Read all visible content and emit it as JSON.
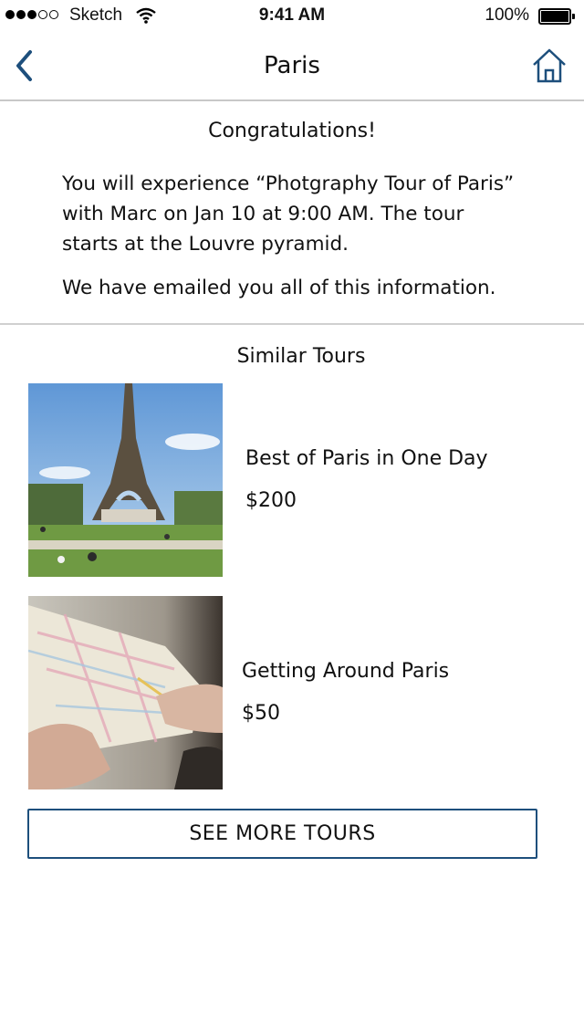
{
  "status_bar": {
    "carrier": "Sketch",
    "time": "9:41 AM",
    "battery": "100%"
  },
  "nav": {
    "title": "Paris",
    "back_icon": "chevron-left-icon",
    "home_icon": "home-icon"
  },
  "confirmation": {
    "heading": "Congratulations!",
    "body": "You will experience “Photgraphy Tour of Paris” with Marc on Jan 10 at 9:00 AM. The tour starts at the Louvre pyramid.",
    "email_note": "We have emailed you all of this information."
  },
  "similar": {
    "heading": "Similar Tours",
    "tours": [
      {
        "name": "Best of Paris in One Day",
        "price": "$200"
      },
      {
        "name": "Getting Around Paris",
        "price": "$50"
      }
    ]
  },
  "see_more_label": "SEE MORE TOURS",
  "colors": {
    "accent": "#1d4f7c",
    "divider": "#c8c8c8"
  }
}
